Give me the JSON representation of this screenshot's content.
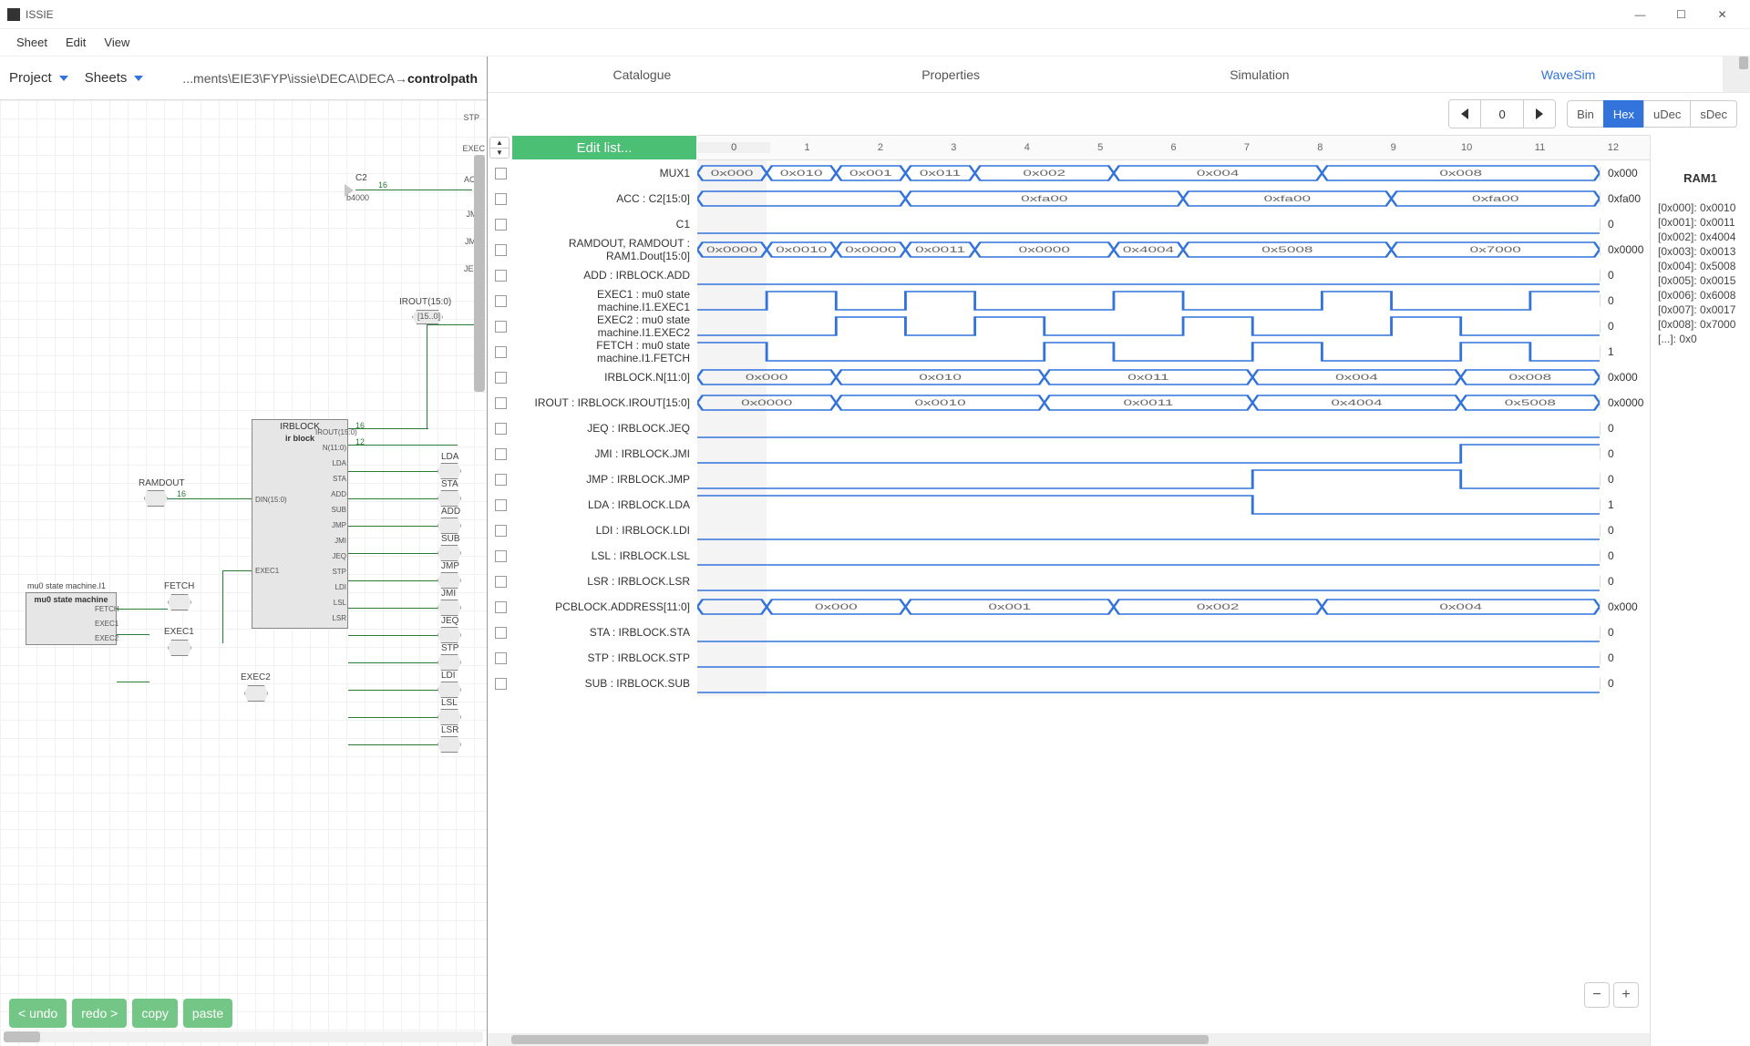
{
  "title": "ISSIE",
  "menubar": [
    "Sheet",
    "Edit",
    "View"
  ],
  "left": {
    "toolbar": {
      "project": "Project",
      "sheets": "Sheets",
      "path_prefix": "...ments\\EIE3\\FYP\\issie\\DECA\\DECA→",
      "path_current": "controlpath"
    },
    "buttons": {
      "undo": "< undo",
      "redo": "redo >",
      "copy": "copy",
      "paste": "paste"
    },
    "schematic": {
      "right_outputs": [
        "STP",
        "EXEC",
        "ACC",
        "JMI",
        "JMP",
        "JEC"
      ],
      "c2_label": "C2",
      "b4000": "b4000",
      "irout_label": "IROUT(15:0)",
      "irout_small": "[15..0]",
      "ramdout": "RAMDOUT",
      "irblock_title": "IRBLOCK",
      "irblock_sub": "ir block",
      "irblock_ports_left": [
        "DIN(15:0)",
        "EXEC1"
      ],
      "irblock_ports_right": [
        "IROUT(15:0)",
        "N(11:0)",
        "LDA",
        "STA",
        "ADD",
        "SUB",
        "JMP",
        "JMI",
        "JEQ",
        "STP",
        "LDI",
        "LSL",
        "LSR"
      ],
      "mu0_title": "mu0 state machine.I1",
      "mu0_sub": "mu0 state machine",
      "mu0_ports": [
        "FETCH",
        "EXEC1",
        "EXEC2"
      ],
      "right_hexes": [
        "LDA",
        "STA",
        "ADD",
        "SUB",
        "JMP",
        "JMI",
        "JEQ",
        "STP",
        "LDI",
        "LSL",
        "LSR"
      ],
      "left_hexes": [
        "FETCH",
        "EXEC1",
        "EXEC2"
      ],
      "wire_16": "16",
      "wire_12": "12"
    }
  },
  "tabs": {
    "cat": "Catalogue",
    "prop": "Properties",
    "sim": "Simulation",
    "wave": "WaveSim"
  },
  "controls": {
    "step": "0",
    "radix": [
      "Bin",
      "Hex",
      "uDec",
      "sDec"
    ],
    "radix_active": 1
  },
  "wave": {
    "edit_list": "Edit list...",
    "ticks": [
      "0",
      "1",
      "2",
      "3",
      "4",
      "5",
      "6",
      "7",
      "8",
      "9",
      "10",
      "11",
      "12"
    ],
    "cursor": 0,
    "rows": [
      {
        "name": "MUX1",
        "type": "bus",
        "val": "0x000",
        "segs": [
          "0x000",
          "0x010",
          "0x001",
          "0x011",
          "0x002",
          "",
          "0x004",
          "",
          "",
          "0x008",
          "",
          ""
        ]
      },
      {
        "name": "ACC : C2[15:0]",
        "type": "bus",
        "val": "0xfa00",
        "segs": [
          "",
          "",
          "",
          "0xfa00",
          "",
          "",
          "",
          "0xfa00",
          "",
          "",
          "0xfa00",
          ""
        ]
      },
      {
        "name": "C1",
        "type": "bit",
        "val": "0",
        "bits": [
          0,
          0,
          0,
          0,
          0,
          0,
          0,
          0,
          0,
          0,
          0,
          0,
          0
        ]
      },
      {
        "name": "RAMDOUT, RAMDOUT : RAM1.Dout[15:0]",
        "type": "bus",
        "val": "0x0000",
        "segs": [
          "0x0000",
          "0x0010",
          "0x0000",
          "0x0011",
          "0x0000",
          "",
          "0x4004",
          "0x5008",
          "",
          "",
          "0x7000",
          ""
        ]
      },
      {
        "name": "ADD : IRBLOCK.ADD",
        "type": "bit",
        "val": "0",
        "bits": [
          0,
          0,
          0,
          0,
          0,
          0,
          0,
          0,
          0,
          0,
          0,
          0,
          0
        ]
      },
      {
        "name": "EXEC1 : mu0 state machine.I1.EXEC1",
        "type": "bit",
        "val": "0",
        "bits": [
          0,
          1,
          0,
          1,
          0,
          0,
          1,
          0,
          0,
          1,
          0,
          0,
          1
        ]
      },
      {
        "name": "EXEC2 : mu0 state machine.I1.EXEC2",
        "type": "bit",
        "val": "0",
        "bits": [
          0,
          0,
          1,
          0,
          1,
          0,
          0,
          1,
          0,
          0,
          1,
          0,
          0
        ]
      },
      {
        "name": "FETCH : mu0 state machine.I1.FETCH",
        "type": "bit",
        "val": "1",
        "bits": [
          1,
          0,
          0,
          0,
          0,
          1,
          0,
          0,
          1,
          0,
          0,
          1,
          0
        ]
      },
      {
        "name": "IRBLOCK.N[11:0]",
        "type": "bus",
        "val": "0x000",
        "segs": [
          "0x000",
          "",
          "0x010",
          "",
          "",
          "0x011",
          "",
          "",
          "0x004",
          "",
          "",
          "0x008"
        ]
      },
      {
        "name": "IROUT : IRBLOCK.IROUT[15:0]",
        "type": "bus",
        "val": "0x0000",
        "segs": [
          "0x0000",
          "",
          "0x0010",
          "",
          "",
          "0x0011",
          "",
          "",
          "0x4004",
          "",
          "",
          "0x5008"
        ]
      },
      {
        "name": "JEQ : IRBLOCK.JEQ",
        "type": "bit",
        "val": "0",
        "bits": [
          0,
          0,
          0,
          0,
          0,
          0,
          0,
          0,
          0,
          0,
          0,
          0,
          0
        ]
      },
      {
        "name": "JMI : IRBLOCK.JMI",
        "type": "bit",
        "val": "0",
        "bits": [
          0,
          0,
          0,
          0,
          0,
          0,
          0,
          0,
          0,
          0,
          0,
          1,
          1
        ]
      },
      {
        "name": "JMP : IRBLOCK.JMP",
        "type": "bit",
        "val": "0",
        "bits": [
          0,
          0,
          0,
          0,
          0,
          0,
          0,
          0,
          1,
          1,
          1,
          0,
          0
        ]
      },
      {
        "name": "LDA : IRBLOCK.LDA",
        "type": "bit",
        "val": "1",
        "bits": [
          1,
          1,
          1,
          1,
          1,
          1,
          1,
          1,
          0,
          0,
          0,
          0,
          0
        ]
      },
      {
        "name": "LDI : IRBLOCK.LDI",
        "type": "bit",
        "val": "0",
        "bits": [
          0,
          0,
          0,
          0,
          0,
          0,
          0,
          0,
          0,
          0,
          0,
          0,
          0
        ]
      },
      {
        "name": "LSL : IRBLOCK.LSL",
        "type": "bit",
        "val": "0",
        "bits": [
          0,
          0,
          0,
          0,
          0,
          0,
          0,
          0,
          0,
          0,
          0,
          0,
          0
        ]
      },
      {
        "name": "LSR : IRBLOCK.LSR",
        "type": "bit",
        "val": "0",
        "bits": [
          0,
          0,
          0,
          0,
          0,
          0,
          0,
          0,
          0,
          0,
          0,
          0,
          0
        ]
      },
      {
        "name": "PCBLOCK.ADDRESS[11:0]",
        "type": "bus",
        "val": "0x000",
        "segs": [
          "",
          "0x000",
          "",
          "0x001",
          "",
          "",
          "0x002",
          "",
          "",
          "0x004",
          "",
          "",
          ""
        ]
      },
      {
        "name": "STA : IRBLOCK.STA",
        "type": "bit",
        "val": "0",
        "bits": [
          0,
          0,
          0,
          0,
          0,
          0,
          0,
          0,
          0,
          0,
          0,
          0,
          0
        ]
      },
      {
        "name": "STP : IRBLOCK.STP",
        "type": "bit",
        "val": "0",
        "bits": [
          0,
          0,
          0,
          0,
          0,
          0,
          0,
          0,
          0,
          0,
          0,
          0,
          0
        ]
      },
      {
        "name": "SUB : IRBLOCK.SUB",
        "type": "bit",
        "val": "0",
        "bits": [
          0,
          0,
          0,
          0,
          0,
          0,
          0,
          0,
          0,
          0,
          0,
          0,
          0
        ]
      }
    ]
  },
  "ram": {
    "title": "RAM1",
    "rows": [
      "[0x000]: 0x0010",
      "[0x001]: 0x0011",
      "[0x002]: 0x4004",
      "[0x003]: 0x0013",
      "[0x004]: 0x5008",
      "[0x005]: 0x0015",
      "[0x006]: 0x6008",
      "[0x007]: 0x0017",
      "[0x008]: 0x7000",
      "[...]: 0x0"
    ]
  },
  "zoom": {
    "minus": "−",
    "plus": "+"
  }
}
